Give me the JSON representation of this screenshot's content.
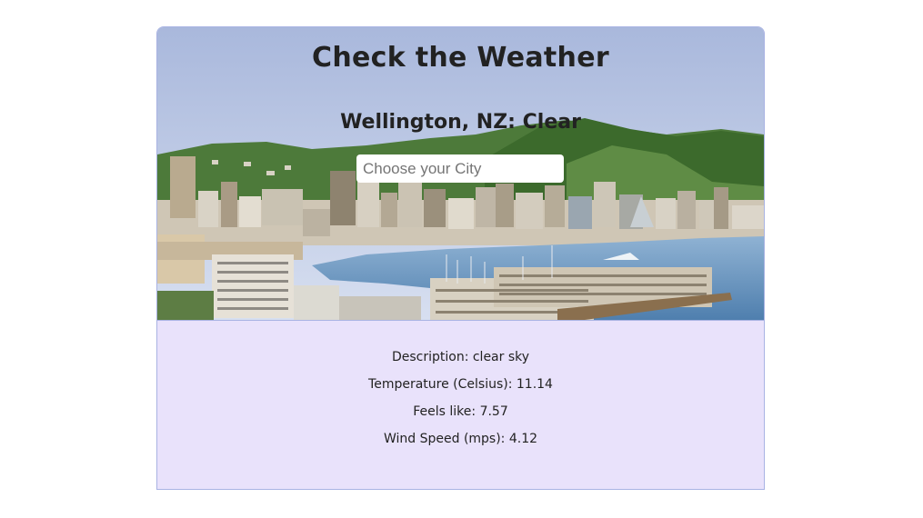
{
  "header": {
    "title": "Check the Weather"
  },
  "current": {
    "summary": "Wellington, NZ: Clear"
  },
  "search": {
    "placeholder": "Choose your City",
    "value": ""
  },
  "details": {
    "description": "Description: clear sky",
    "temperature": "Temperature (Celsius): 11.14",
    "feels_like": "Feels like: 7.57",
    "wind_speed": "Wind Speed (mps): 4.12"
  },
  "colors": {
    "panel_background": "#e9e2fb",
    "border": "#a9b3e3",
    "sky": "#c6d2ea",
    "water": "#6f9bc4",
    "hills": "#3f6e2f"
  },
  "hero_image": {
    "description": "Wellington harbour skyline"
  }
}
